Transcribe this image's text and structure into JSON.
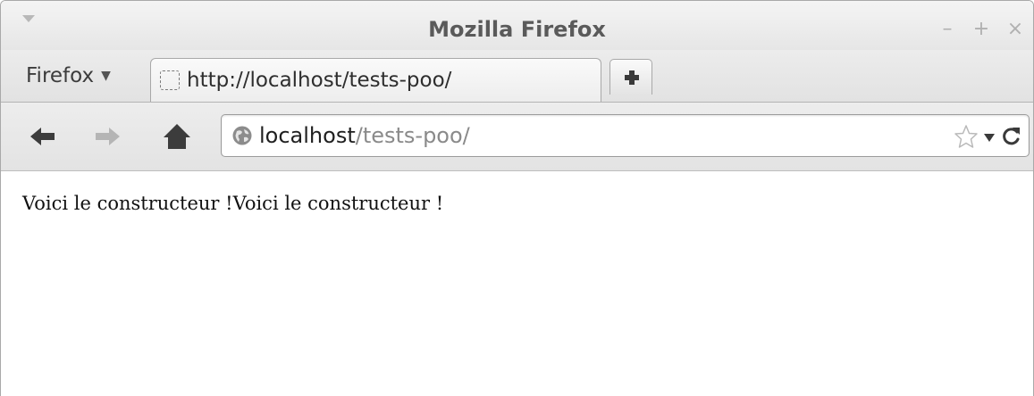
{
  "window": {
    "title": "Mozilla Firefox",
    "controls": {
      "minimize": "–",
      "maximize": "+",
      "close": "×"
    }
  },
  "tabstrip": {
    "menu_label": "Firefox",
    "menu_caret": "▼",
    "tabs": [
      {
        "title": "http://localhost/tests-poo/",
        "icon": "blank-page-favicon-icon",
        "active": true
      }
    ],
    "new_tab_icon": "plus-icon"
  },
  "navbar": {
    "back_icon": "arrow-left-icon",
    "forward_icon": "arrow-right-icon",
    "home_icon": "home-icon",
    "url": {
      "host": "localhost",
      "path": "/tests-poo/",
      "site_icon": "globe-icon"
    },
    "bookmark_icon": "star-icon",
    "history_dropdown_icon": "dropdown-arrow-icon",
    "reload_icon": "reload-icon"
  },
  "page": {
    "body_text": "Voici le constructeur !Voici le constructeur !"
  },
  "colors": {
    "chrome_bg": "#e6e6e6",
    "title_text": "#5a5a5a",
    "url_path": "#8a8a8a",
    "page_bg": "#ffffff"
  }
}
